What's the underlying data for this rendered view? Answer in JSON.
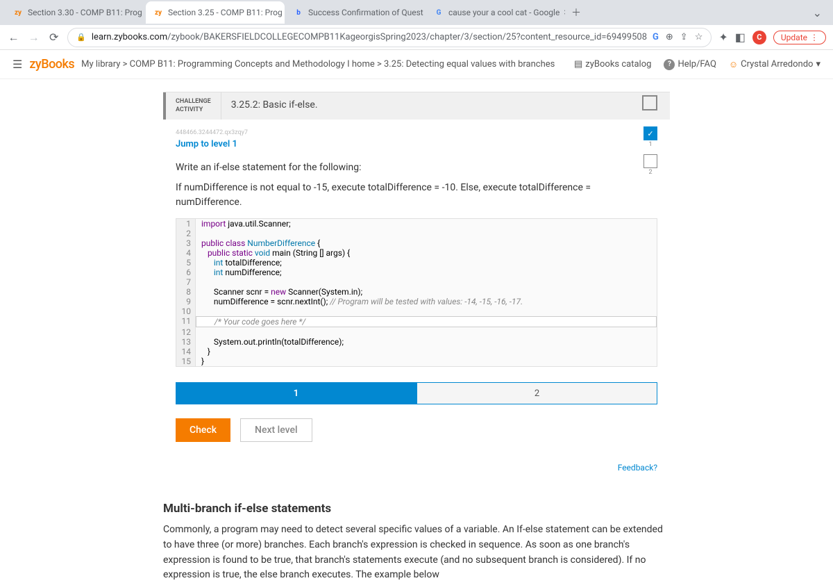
{
  "tabs": [
    {
      "favicon": "zy",
      "faviconColor": "#f57c00",
      "title": "Section 3.30 - COMP B11: Prog"
    },
    {
      "favicon": "zy",
      "faviconColor": "#f57c00",
      "title": "Section 3.25 - COMP B11: Prog"
    },
    {
      "favicon": "b",
      "faviconColor": "#2962ff",
      "title": "Success Confirmation of Quest"
    },
    {
      "favicon": "G",
      "faviconColor": "#4285f4",
      "title": "cause your a cool cat - Google"
    }
  ],
  "activeTabIndex": 1,
  "url": {
    "domain": "learn.zybooks.com",
    "path": "/zybook/BAKERSFIELDCOLLEGECOMPB11KageorgisSpring2023/chapter/3/section/25?content_resource_id=69499508"
  },
  "updateLabel": "Update",
  "logo": "zyBooks",
  "breadcrumbs": "My library > COMP B11: Programming Concepts and Methodology I home > 3.25: Detecting equal values with branches",
  "headerLinks": {
    "catalog": "zyBooks catalog",
    "help": "Help/FAQ",
    "user": "Crystal Arredondo"
  },
  "activity": {
    "typeLine1": "CHALLENGE",
    "typeLine2": "ACTIVITY",
    "title": "3.25.2: Basic if-else.",
    "idCode": "448466.3244472.qx3zqy7",
    "jump": "Jump to level 1",
    "levels": [
      {
        "done": true,
        "num": "1"
      },
      {
        "done": false,
        "num": "2"
      }
    ],
    "instr1": "Write an if-else statement for the following:",
    "instr2": "If numDifference is not equal to -15, execute totalDifference = -10. Else, execute totalDifference = numDifference.",
    "pagerLevels": [
      "1",
      "2"
    ],
    "pagerActive": 0,
    "checkLabel": "Check",
    "nextLabel": "Next level",
    "feedback": "Feedback?"
  },
  "code": {
    "lines": [
      {
        "n": "1",
        "html": "<span class='kw'>import</span> java.util.Scanner;"
      },
      {
        "n": "2",
        "html": ""
      },
      {
        "n": "3",
        "html": "<span class='kw'>public class</span> <span class='cls'>NumberDifference</span> {"
      },
      {
        "n": "4",
        "html": "   <span class='kw'>public static</span> <span class='type'>void</span> main (String [] args) {"
      },
      {
        "n": "5",
        "html": "      <span class='type'>int</span> totalDifference;"
      },
      {
        "n": "6",
        "html": "      <span class='type'>int</span> numDifference;"
      },
      {
        "n": "7",
        "html": ""
      },
      {
        "n": "8",
        "html": "      Scanner scnr = <span class='kw'>new</span> Scanner(System.in);"
      },
      {
        "n": "9",
        "html": "      numDifference = scnr.nextInt(); <span class='com'>// Program will be tested with values: -14, -15, -16, -17.</span>"
      },
      {
        "n": "10",
        "html": ""
      },
      {
        "n": "11",
        "html": "      <span class='com'>/* Your code goes here */</span>",
        "editable": true
      },
      {
        "n": "12",
        "html": ""
      },
      {
        "n": "13",
        "html": "      System.out.println(totalDifference);"
      },
      {
        "n": "14",
        "html": "   }"
      },
      {
        "n": "15",
        "html": "}"
      }
    ]
  },
  "section": {
    "heading": "Multi-branch if-else statements",
    "body": "Commonly, a program may need to detect several specific values of a variable. An If-else statement can be extended to have three (or more) branches. Each branch's expression is checked in sequence. As soon as one branch's expression is found to be true, that branch's statements execute (and no subsequent branch is considered). If no expression is true, the else branch executes. The example below"
  }
}
